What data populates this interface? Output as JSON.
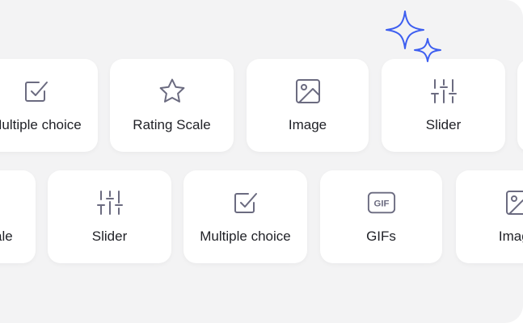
{
  "row1": [
    {
      "label": "Multiple choice",
      "icon": "checkbox-icon"
    },
    {
      "label": "Rating Scale",
      "icon": "star-icon"
    },
    {
      "label": "Image",
      "icon": "image-icon"
    },
    {
      "label": "Slider",
      "icon": "slider-icon"
    }
  ],
  "row2": [
    {
      "label": "Rating Scale",
      "icon": "star-icon"
    },
    {
      "label": "Slider",
      "icon": "slider-icon"
    },
    {
      "label": "Multiple choice",
      "icon": "checkbox-icon"
    },
    {
      "label": "GIFs",
      "icon": "gif-icon"
    },
    {
      "label": "Image",
      "icon": "image-icon"
    }
  ],
  "gif_badge_text": "GIF",
  "colors": {
    "background": "#f3f3f4",
    "card": "#ffffff",
    "icon": "#6b6b80",
    "text": "#1f2026",
    "sparkle": "#3d5ef0"
  }
}
